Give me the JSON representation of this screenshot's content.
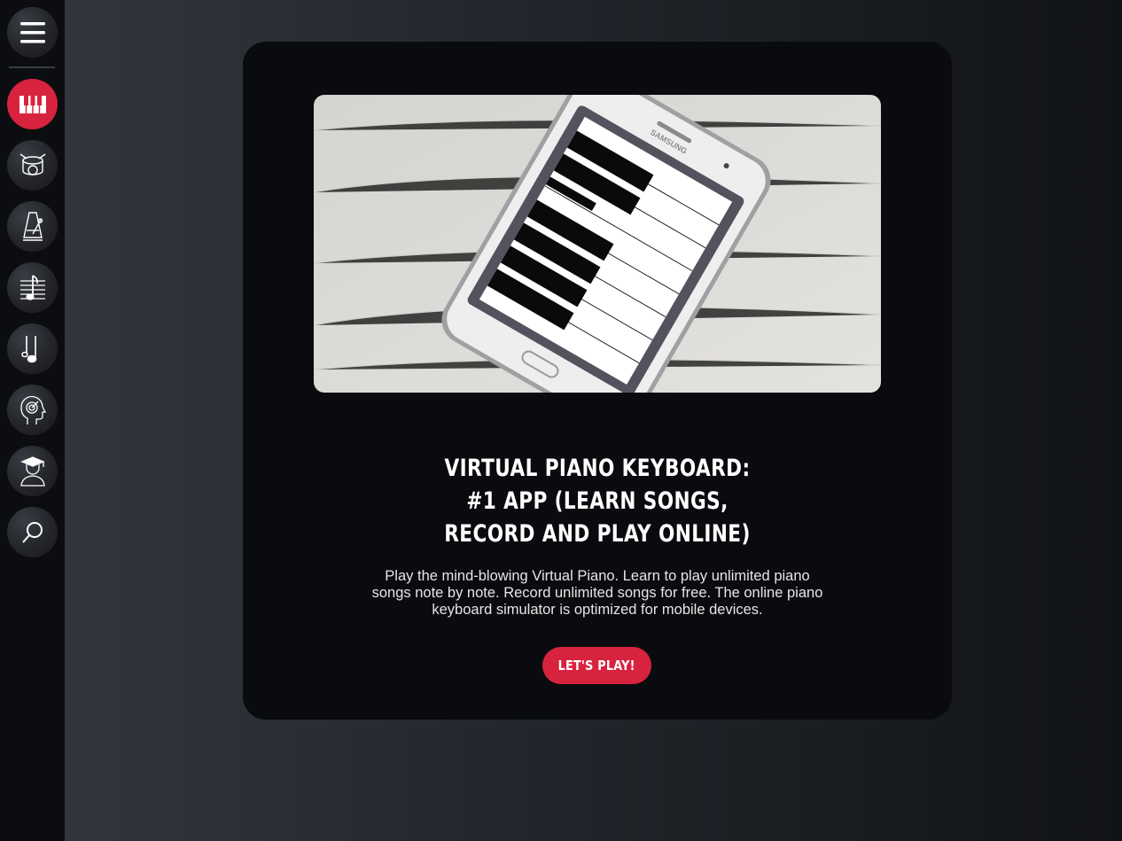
{
  "sidebar": {
    "items": [
      {
        "name": "menu-button",
        "icon": "hamburger-menu-icon",
        "active": false
      },
      {
        "name": "piano-button",
        "icon": "piano-keys-icon",
        "active": true
      },
      {
        "name": "drums-button",
        "icon": "drum-icon",
        "active": false
      },
      {
        "name": "metronome-button",
        "icon": "metronome-icon",
        "active": false
      },
      {
        "name": "sheet-music-button",
        "icon": "sheet-music-icon",
        "active": false
      },
      {
        "name": "music-note-button",
        "icon": "music-note-icon",
        "active": false
      },
      {
        "name": "ear-training-button",
        "icon": "head-target-icon",
        "active": false
      },
      {
        "name": "lessons-button",
        "icon": "graduate-icon",
        "active": false
      },
      {
        "name": "search-button",
        "icon": "search-icon",
        "active": false
      }
    ],
    "active_color": "#d8233f"
  },
  "card": {
    "title": "VIRTUAL PIANO KEYBOARD: #1 APP (LEARN SONGS, RECORD AND PLAY ONLINE)",
    "description": "Play the mind-blowing Virtual Piano. Learn to play unlimited piano songs note by note. Record unlimited songs for free. The online piano keyboard simulator is optimized for mobile devices.",
    "cta_label": "LET'S PLAY!",
    "image_brand": "SAMSUNG"
  },
  "colors": {
    "accent": "#d8233f",
    "card_bg": "#0a0b0e",
    "sidebar_bg": "#0c0d10"
  }
}
